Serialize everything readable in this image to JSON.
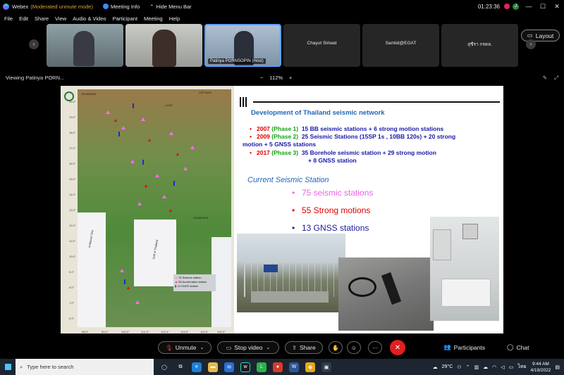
{
  "titlebar": {
    "app_name": "Webex",
    "mode": "(Moderated unmute mode)",
    "meeting_info": "Meeting Info",
    "hide_menu": "Hide Menu Bar",
    "clock": "01:23:36",
    "badge_letter": "J",
    "minimize": "—",
    "maximize": "☐",
    "close": "✕"
  },
  "menu": [
    "File",
    "Edit",
    "Share",
    "View",
    "Audio & Video",
    "Participant",
    "Meeting",
    "Help"
  ],
  "participants": [
    {
      "name": "",
      "video": true,
      "color": "#7a8a90"
    },
    {
      "name": "",
      "video": true,
      "color": "#9a9c98"
    },
    {
      "name": "Patinya PORNSOPIN (Host)",
      "video": true,
      "color": "#8aa0b8",
      "active": true
    },
    {
      "name": "Chayut Siriwat",
      "video": false
    },
    {
      "name": "Samlid@EGAT",
      "video": false
    },
    {
      "name": "สุชีรา กรดล.",
      "video": false
    }
  ],
  "layout_label": "Layout",
  "view_row": {
    "viewing": "Viewing Patinya PORN...",
    "zoom_minus": "−",
    "zoom_value": "112%",
    "zoom_plus": "+"
  },
  "slide": {
    "title": "Development of Thailand seismic network",
    "phases": [
      {
        "year": "2007",
        "phase": "(Phase 1)",
        "text": "15 BB seismic stations + 6 strong motion stations",
        "cont": ""
      },
      {
        "year": "2009",
        "phase": "(Phase 2)",
        "text": "25 Seismic Stations (15SP 1s , 10BB 120s) + 20 strong",
        "cont": "motion + 5 GNSS stations"
      },
      {
        "year": "2017",
        "phase": "(Phase 3)",
        "text": "35 Borehole seismic station + 29 strong motion",
        "cont": "+ 8 GNSS station"
      }
    ],
    "current_title": "Current Seismic Station",
    "stations": [
      {
        "text": "75 seismic stations",
        "color": "#f060e8"
      },
      {
        "text": "55 Strong motions",
        "color": "#e00000"
      },
      {
        "text": "13 GNSS stations",
        "color": "#1818a8"
      }
    ],
    "map": {
      "labels": {
        "myanmar": "MYANMAR",
        "laos": "LAOS",
        "vietnam": "VIETNAM",
        "cambodia": "CAMBODIA",
        "andaman": "Andaman Sea",
        "gulf": "Gulf of Thailand",
        "bangkok": "Bangkok",
        "chiangmai": "Chiang Mai",
        "songkhla": "Songkhla"
      },
      "legend": [
        "75 Seismic station",
        "55 Acceleration station",
        "13 GNSS station"
      ],
      "lats": [
        "20.0°",
        "19.0°",
        "18.0°",
        "17.0°",
        "16.0°",
        "15.0°",
        "14.0°",
        "13.0°",
        "12.0°",
        "11.0°",
        "10.0°",
        "9.0°",
        "8.0°",
        "7.0°",
        "6.0°"
      ],
      "lons": [
        "98.0°",
        "99.0°",
        "100.0°",
        "101.0°",
        "102.0°",
        "103.0°",
        "104.0°",
        "105.0°"
      ]
    }
  },
  "controls": {
    "unmute": "Unmute",
    "stop_video": "Stop video",
    "share": "Share",
    "more": "···",
    "end": "✕",
    "participants": "Participants",
    "chat": "Chat"
  },
  "taskbar": {
    "search_placeholder": "Type here to search",
    "temperature": "29°C",
    "language": "ไทย",
    "time": "9:44 AM",
    "date": "4/19/2022"
  }
}
